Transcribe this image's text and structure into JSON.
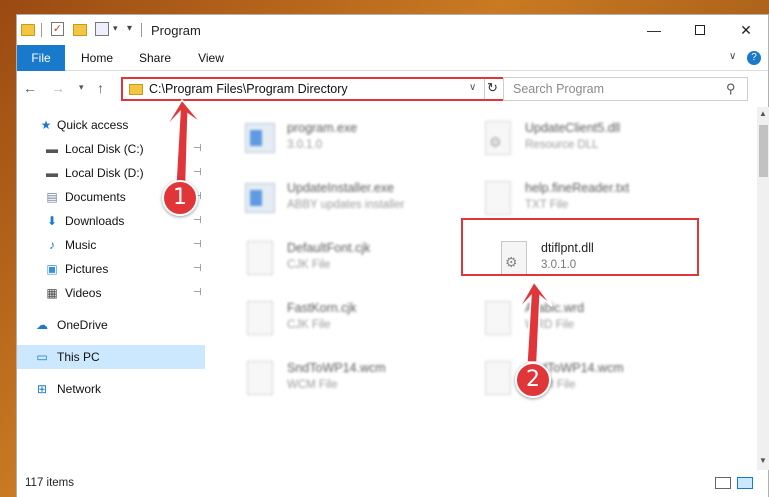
{
  "window": {
    "title": "Program",
    "minimize_glyph": "—",
    "close_glyph": "✕"
  },
  "quick_access_toolbar": {
    "check_glyph": "✓",
    "dropdown_glyph": "▾",
    "customize_glyph": "▾"
  },
  "ribbon": {
    "tabs": [
      {
        "label": "File"
      },
      {
        "label": "Home"
      },
      {
        "label": "Share"
      },
      {
        "label": "View"
      }
    ],
    "collapse_glyph": "∨",
    "help_glyph": "?"
  },
  "navigation": {
    "back_glyph": "←",
    "forward_glyph": "→",
    "recent_glyph": "▾",
    "up_glyph": "↑",
    "address": "C:\\Program Files\\Program Directory",
    "address_dropdown_glyph": "∨",
    "refresh_glyph": "↻",
    "search_placeholder": "Search Program",
    "search_glyph": "⚲"
  },
  "nav_pane": {
    "items": [
      {
        "label": "Quick access",
        "icon": "star-icon"
      },
      {
        "label": "Local Disk (C:)",
        "icon": "drive-icon",
        "pinned": true
      },
      {
        "label": "Local Disk (D:)",
        "icon": "drive-icon",
        "pinned": true
      },
      {
        "label": "Documents",
        "icon": "documents-icon",
        "pinned": true
      },
      {
        "label": "Downloads",
        "icon": "download-icon",
        "pinned": true
      },
      {
        "label": "Music",
        "icon": "music-icon",
        "pinned": true
      },
      {
        "label": "Pictures",
        "icon": "pictures-icon",
        "pinned": true
      },
      {
        "label": "Videos",
        "icon": "videos-icon",
        "pinned": true
      },
      {
        "label": "OneDrive",
        "icon": "cloud-icon"
      },
      {
        "label": "This PC",
        "icon": "computer-icon",
        "selected": true
      },
      {
        "label": "Network",
        "icon": "network-icon"
      }
    ],
    "pin_glyph": "📌"
  },
  "files": [
    {
      "name": "program.exe",
      "sub": "3.0.1.0",
      "icon": "exe-icon"
    },
    {
      "name": "UpdateClient5.dll",
      "sub": "Resource DLL",
      "icon": "dll-icon"
    },
    {
      "name": "UpdateInstaller.exe",
      "sub": "ABBY updates installer",
      "icon": "installer-icon"
    },
    {
      "name": "help.fineReader.txt",
      "sub": "TXT File",
      "icon": "txt-icon"
    },
    {
      "name": "DefaultFont.cjk",
      "sub": "CJK File",
      "icon": "file-icon"
    },
    {
      "name": "dtiflpnt.dll",
      "sub": "3.0.1.0",
      "icon": "dll-icon",
      "highlighted": true
    },
    {
      "name": "FastKorn.cjk",
      "sub": "CJK File",
      "icon": "file-icon"
    },
    {
      "name": "Arabic.wrd",
      "sub": "WRD File",
      "icon": "file-icon"
    },
    {
      "name": "SndToWP14.wcm",
      "sub": "WCM File",
      "icon": "file-icon"
    },
    {
      "name": "SndToWP14.wcm",
      "sub": "WCM File",
      "icon": "file-icon"
    }
  ],
  "status": {
    "item_count": "117 items"
  },
  "annotations": {
    "step1": "1",
    "step2": "2",
    "color": "#e0363a"
  },
  "colors": {
    "accent": "#1979ca",
    "selection": "#cce8ff"
  }
}
